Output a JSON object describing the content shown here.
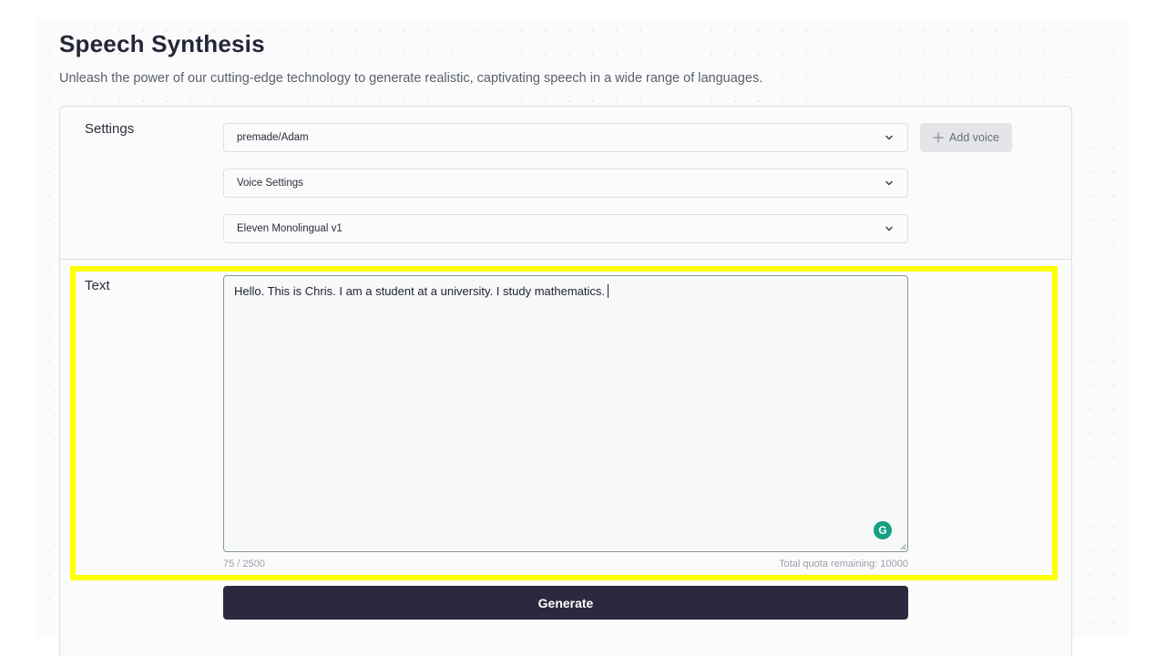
{
  "header": {
    "title": "Speech Synthesis",
    "subtitle": "Unleash the power of our cutting-edge technology to generate realistic, captivating speech in a wide range of languages."
  },
  "settings": {
    "label": "Settings",
    "voice_select": {
      "value": "premade/Adam",
      "icon": "chevron-down-icon"
    },
    "voice_settings": {
      "value": "Voice Settings",
      "icon": "chevron-down-icon"
    },
    "model_select": {
      "value": "Eleven Monolingual v1",
      "icon": "chevron-down-icon"
    },
    "add_voice": {
      "label": "Add voice",
      "icon": "plus-icon"
    }
  },
  "text_section": {
    "label": "Text",
    "value": "Hello. This is Chris. I am a student at a university. I study mathematics.",
    "char_count": "75 / 2500",
    "quota": "Total quota remaining: 10000",
    "assistant_badge": "G"
  },
  "actions": {
    "generate_label": "Generate"
  },
  "colors": {
    "highlight": "#ffff00",
    "generate_bg": "#2d283d",
    "grammarly": "#15a080"
  }
}
